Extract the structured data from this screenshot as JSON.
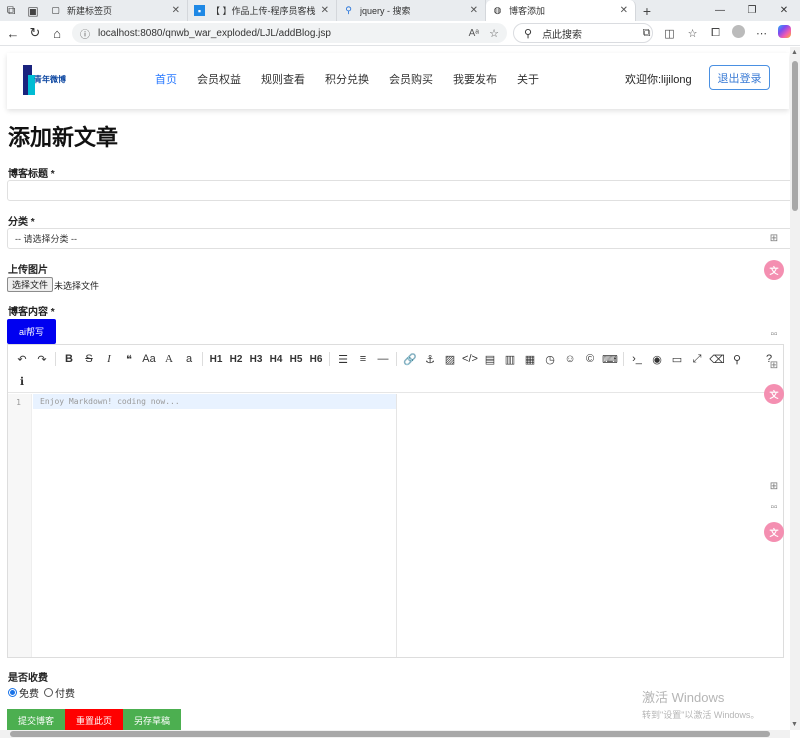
{
  "browser": {
    "tabs": [
      {
        "title": "新建标签页",
        "icon": "new-tab-icon",
        "active": false
      },
      {
        "title": "【        】作品上传-程序员客栈",
        "icon": "site-favicon",
        "active": false
      },
      {
        "title": "jquery - 搜索",
        "icon": "search-icon",
        "active": false
      },
      {
        "title": "博客添加",
        "icon": "globe-icon",
        "active": true
      }
    ],
    "url": "localhost:8080/qnwb_war_exploded/LJL/addBlog.jsp",
    "search_placeholder": "点此搜索"
  },
  "header": {
    "logo_text": "青年微博",
    "nav": [
      "首页",
      "会员权益",
      "规则查看",
      "积分兑换",
      "会员购买",
      "我要发布",
      "关于"
    ],
    "active_nav": "首页",
    "welcome": "欢迎你:lijilong",
    "logout_label": "退出登录"
  },
  "form": {
    "page_title": "添加新文章",
    "title_label": "博客标题 *",
    "title_value": "",
    "category_label": "分类 *",
    "category_selected": "-- 请选择分类 --",
    "image_label": "上传图片",
    "file_button": "选择文件",
    "file_status": "未选择文件",
    "content_label": "博客内容 *",
    "ai_button": "ai帮写",
    "editor": {
      "line_number": "1",
      "placeholder": "Enjoy Markdown! coding now...",
      "headings": [
        "H1",
        "H2",
        "H3",
        "H4",
        "H5",
        "H6"
      ]
    },
    "paid_label": "是否收费",
    "options": {
      "free": "免费",
      "paid": "付费"
    },
    "selected_option": "free",
    "submit": "提交博客",
    "reset": "重置此页",
    "draft": "另存草稿",
    "colors": {
      "submit": "#4caf50",
      "reset": "#ff0000",
      "draft": "#4caf50",
      "ai": "#0000f0",
      "accent": "#2979ff"
    }
  },
  "watermark": {
    "line1": "激活 Windows",
    "line2": "转到\"设置\"以激活 Windows。"
  }
}
